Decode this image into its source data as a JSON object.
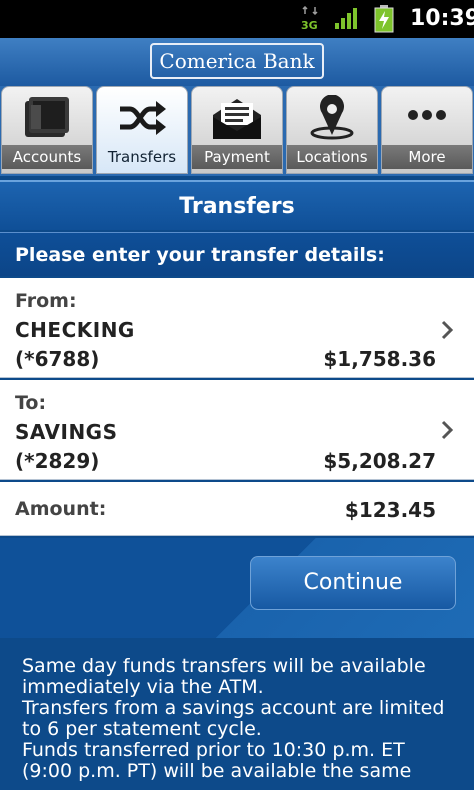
{
  "status_bar": {
    "network": "3G",
    "time": "10:39"
  },
  "brand": {
    "logo_text": "Comerica Bank"
  },
  "tabs": [
    {
      "label": "Accounts",
      "icon": "wallet-icon",
      "active": false
    },
    {
      "label": "Transfers",
      "icon": "shuffle-icon",
      "active": true
    },
    {
      "label": "Payment",
      "icon": "envelope-icon",
      "active": false
    },
    {
      "label": "Locations",
      "icon": "map-pin-icon",
      "active": false
    },
    {
      "label": "More",
      "icon": "more-icon",
      "active": false
    }
  ],
  "page": {
    "title": "Transfers",
    "prompt": "Please enter your transfer details:"
  },
  "from": {
    "label": "From:",
    "account_name": "CHECKING",
    "account_number": "(*6788)",
    "balance": "$1,758.36"
  },
  "to": {
    "label": "To:",
    "account_name": "SAVINGS",
    "account_number": "(*2829)",
    "balance": "$5,208.27"
  },
  "amount": {
    "label": "Amount:",
    "value": "$123.45"
  },
  "actions": {
    "continue_label": "Continue"
  },
  "notes": [
    "Same day funds transfers will be available immediately via the ATM.",
    "Transfers from a savings account are limited to 6 per statement cycle.",
    "Funds transferred prior to 10:30 p.m. ET (9:00 p.m. PT) will be available the same"
  ],
  "colors": {
    "brand_blue": "#0d4a8a",
    "header_blue": "#1d64b0",
    "tab_active": "#d7e7f7"
  }
}
